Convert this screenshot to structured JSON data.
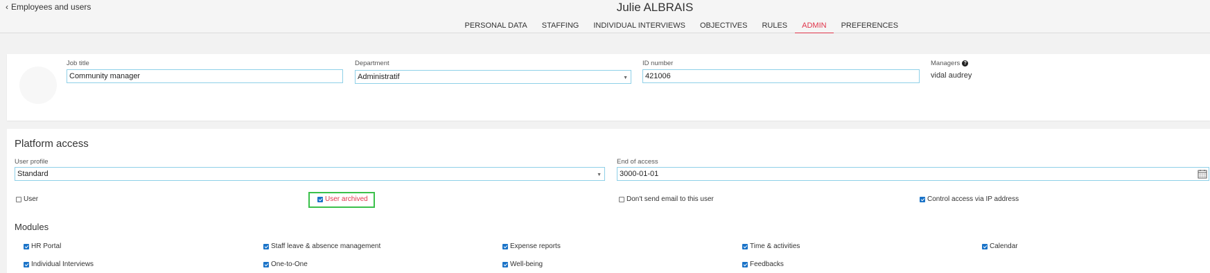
{
  "header": {
    "back_label": "Employees and users",
    "person_name": "Julie ALBRAIS",
    "tabs": [
      {
        "label": "PERSONAL DATA",
        "active": false
      },
      {
        "label": "STAFFING",
        "active": false
      },
      {
        "label": "INDIVIDUAL INTERVIEWS",
        "active": false
      },
      {
        "label": "OBJECTIVES",
        "active": false
      },
      {
        "label": "RULES",
        "active": false
      },
      {
        "label": "ADMIN",
        "active": true
      },
      {
        "label": "PREFERENCES",
        "active": false
      }
    ]
  },
  "profile": {
    "job_title_label": "Job title",
    "job_title_value": "Community manager",
    "department_label": "Department",
    "department_value": "Administratif",
    "id_number_label": "ID number",
    "id_number_value": "421006",
    "managers_label": "Managers",
    "managers_value": "vidal audrey"
  },
  "platform_access": {
    "title": "Platform access",
    "user_profile_label": "User profile",
    "user_profile_value": "Standard",
    "end_of_access_label": "End of access",
    "end_of_access_value": "3000-01-01",
    "options": [
      {
        "label": "User",
        "checked": false
      },
      {
        "label": "User archived",
        "checked": true
      },
      {
        "label": "Don't send email to this user",
        "checked": false
      },
      {
        "label": "Control access via IP address",
        "checked": true
      }
    ]
  },
  "modules": {
    "title": "Modules",
    "items": [
      {
        "label": "HR Portal",
        "checked": true
      },
      {
        "label": "Staff leave & absence management",
        "checked": true
      },
      {
        "label": "Expense reports",
        "checked": true
      },
      {
        "label": "Time & activities",
        "checked": true
      },
      {
        "label": "Calendar",
        "checked": true
      },
      {
        "label": "Individual Interviews",
        "checked": true
      },
      {
        "label": "One-to-One",
        "checked": true
      },
      {
        "label": "Well-being",
        "checked": true
      },
      {
        "label": "Feedbacks",
        "checked": true
      }
    ]
  },
  "colors": {
    "accent": "#e0344a",
    "field_border": "#8ed0e8",
    "highlight_box": "#3ac04a",
    "checkbox": "#1a73c8"
  }
}
